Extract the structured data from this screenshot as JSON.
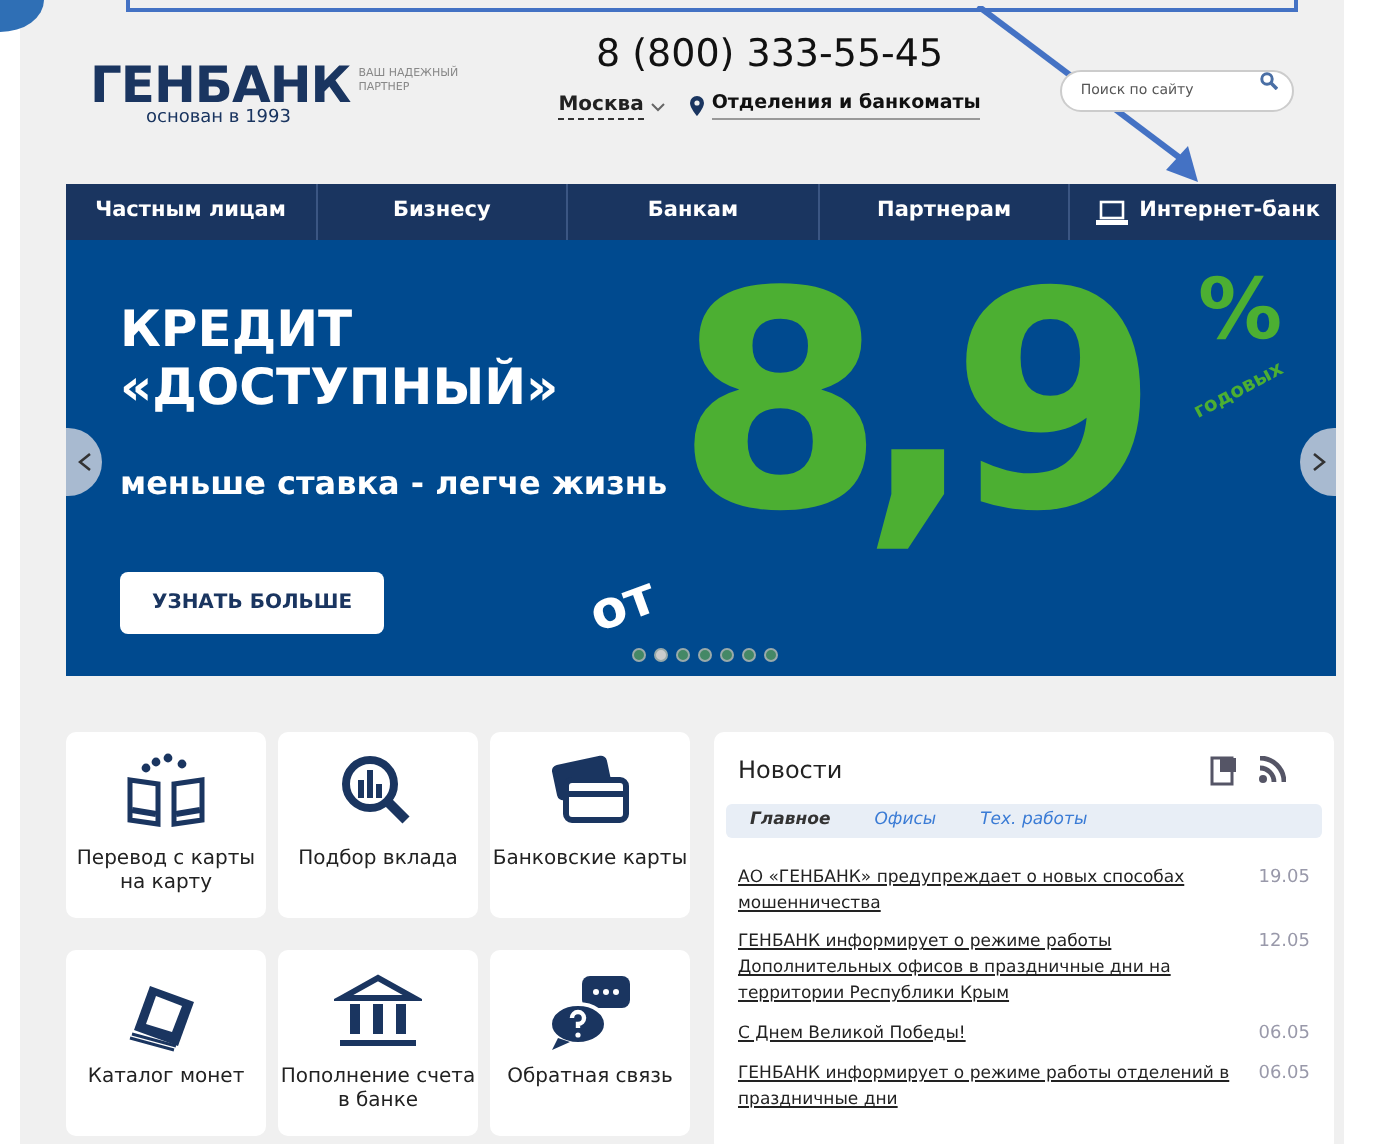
{
  "header": {
    "logo": "ГЕНБАНК",
    "founded": "основан в 1993",
    "slogan": "ВАШ НАДЕЖНЫЙ ПАРТНЕР",
    "phone": "8 (800) 333-55-45",
    "city": "Москва",
    "offices_link": "Отделения и банкоматы",
    "search": {
      "placeholder": "Поиск по сайту"
    }
  },
  "nav": [
    {
      "label": "Частным лицам",
      "kind": "text"
    },
    {
      "label": "Бизнесу",
      "kind": "text"
    },
    {
      "label": "Банкам",
      "kind": "text"
    },
    {
      "label": "Партнерам",
      "kind": "text"
    },
    {
      "label": "Интернет-банк",
      "kind": "laptop"
    }
  ],
  "banner": {
    "title_1": "КРЕДИТ",
    "title_2": "«ДОСТУПНЫЙ»",
    "subtitle": "меньше ставка - легче жизнь",
    "button": "УЗНАТЬ БОЛЬШЕ",
    "rate_prefix": "от",
    "rate": "8,9",
    "percent": "%",
    "rate_suffix": "годовых",
    "dots": [
      {
        "selected": false
      },
      {
        "selected": true
      },
      {
        "selected": false
      },
      {
        "selected": false
      },
      {
        "selected": false
      },
      {
        "selected": false
      },
      {
        "selected": false
      }
    ]
  },
  "services": [
    {
      "label": "Перевод с карты на карту",
      "kind": "transfer"
    },
    {
      "label": "Подбор вклада",
      "kind": "deposit"
    },
    {
      "label": "Банковские карты",
      "kind": "cards"
    },
    {
      "label": "Каталог монет",
      "kind": "coins"
    },
    {
      "label": "Пополнение счета в банке",
      "kind": "bank"
    },
    {
      "label": "Обратная связь",
      "kind": "feedback"
    }
  ],
  "news": {
    "title": "Новости",
    "tabs": [
      {
        "label": "Главное",
        "selected": true
      },
      {
        "label": "Офисы",
        "selected": false
      },
      {
        "label": "Тех. работы",
        "selected": false
      }
    ],
    "items": [
      {
        "text": "АО «ГЕНБАНК» предупреждает о новых способах мошенничества",
        "date": "19.05"
      },
      {
        "text": "ГЕНБАНК информирует о режиме работы Дополнительных офисов в праздничные дни на территории Республики Крым",
        "date": "12.05"
      },
      {
        "text": "С Днем Великой Победы!",
        "date": "06.05"
      },
      {
        "text": "ГЕНБАНК информирует о режиме работы отделений в праздничные дни",
        "date": "06.05"
      }
    ]
  }
}
